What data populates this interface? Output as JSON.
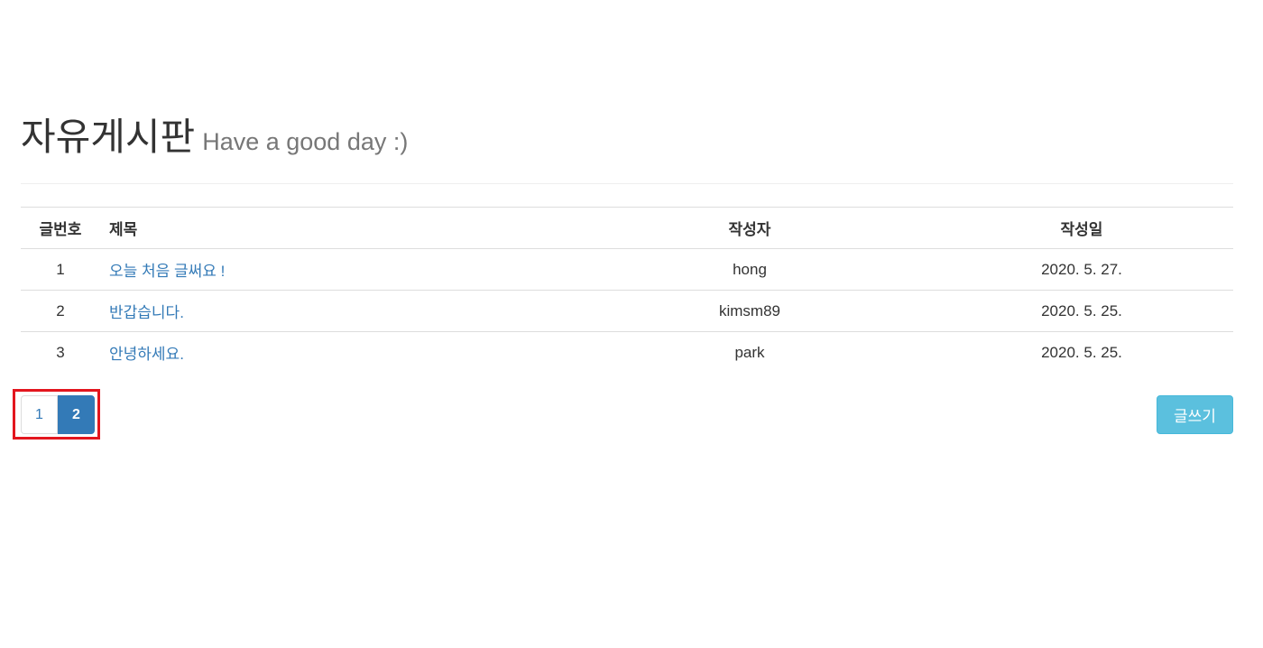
{
  "header": {
    "title": "자유게시판",
    "subtitle": "Have a good day :)"
  },
  "table": {
    "columns": [
      "글번호",
      "제목",
      "작성자",
      "작성일"
    ],
    "rows": [
      {
        "no": "1",
        "title": "오늘 처음 글써요 !",
        "writer": "hong",
        "date": "2020. 5. 27."
      },
      {
        "no": "2",
        "title": "반갑습니다.",
        "writer": "kimsm89",
        "date": "2020. 5. 25."
      },
      {
        "no": "3",
        "title": "안녕하세요.",
        "writer": "park",
        "date": "2020. 5. 25."
      }
    ]
  },
  "pagination": {
    "pages": [
      "1",
      "2"
    ],
    "active_page": "2",
    "highlight_color": "#e3161e"
  },
  "actions": {
    "write_label": "글쓰기"
  },
  "colors": {
    "link": "#337ab7",
    "active_page_bg": "#337ab7",
    "write_button_bg": "#5bc0de",
    "subtitle": "#777777"
  }
}
